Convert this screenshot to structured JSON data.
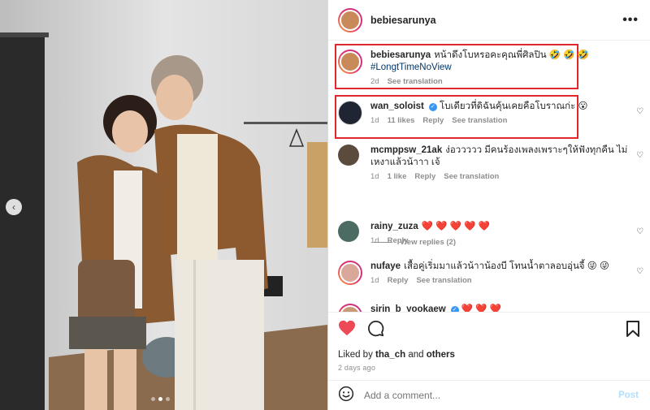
{
  "post": {
    "username": "bebiesarunya",
    "more_icon": "more-horizontal-icon"
  },
  "caption": {
    "username": "bebiesarunya",
    "text": "หน้าดึงโบหรอคะคุณพี่ศิลปิน 🤣 🤣 🤣",
    "hashtag": "#LongtTimeNoView",
    "time": "2d",
    "see_translation": "See translation"
  },
  "comments": [
    {
      "username": "wan_soloist",
      "verified": true,
      "text": "โบเดียวที่ดิฉันคุ้นเคยคือโบราณก่ะ 😮",
      "time": "1d",
      "likes": "11 likes",
      "reply": "Reply",
      "see_translation": "See translation"
    },
    {
      "username": "mcmppsw_21ak",
      "verified": false,
      "text": "ง่อววววว มีคนร้องเพลงเพราะๆให้ฟังทุกคืน ไม่เหงาแล้วน้าาา เจ้",
      "time": "1d",
      "likes": "1 like",
      "reply": "Reply",
      "see_translation": "See translation",
      "view_replies": "View replies (2)"
    },
    {
      "username": "rainy_zuza",
      "verified": false,
      "text": "❤️ ❤️ ❤️ ❤️ ❤️",
      "time": "1d",
      "reply": "Reply"
    },
    {
      "username": "nufaye",
      "verified": false,
      "text": "เสื้อคู่เริ่มมาแล้วน้าาน้องบี โทนน้ำตาลอบอุ่นจี้ 😜 😜",
      "time": "1d",
      "reply": "Reply",
      "see_translation": "See translation"
    },
    {
      "username": "sirin_b_yookaew",
      "verified": true,
      "text": "❤️ ❤️ ❤️"
    }
  ],
  "actions": {
    "like_icon": "heart-filled-icon",
    "comment_icon": "comment-icon",
    "save_icon": "bookmark-icon",
    "liked_by_prefix": "Liked by",
    "liked_by_user": "tha_ch",
    "liked_by_and": "and",
    "liked_by_others": "others",
    "time_ago": "2 days ago"
  },
  "add_comment": {
    "emoji_icon": "emoji-icon",
    "placeholder": "Add a comment...",
    "post_label": "Post"
  },
  "carousel": {
    "index": 2,
    "count": 3,
    "prev_icon": "chevron-left-icon"
  },
  "colors": {
    "highlight": "#e0282d",
    "like": "#ed4956",
    "link": "#00376b",
    "verified": "#3897f0",
    "post_disabled": "#b2dffc"
  }
}
